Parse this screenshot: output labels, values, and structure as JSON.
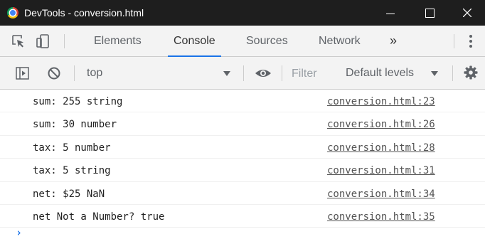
{
  "window": {
    "title": "DevTools - conversion.html"
  },
  "tabs": [
    {
      "label": "Elements",
      "active": false
    },
    {
      "label": "Console",
      "active": true
    },
    {
      "label": "Sources",
      "active": false
    },
    {
      "label": "Network",
      "active": false
    }
  ],
  "more_tabs_glyph": "»",
  "toolbar": {
    "context": "top",
    "filter_placeholder": "Filter",
    "levels_label": "Default levels"
  },
  "messages": [
    {
      "text": "sum: 255 string",
      "source": "conversion.html:23"
    },
    {
      "text": "sum: 30 number",
      "source": "conversion.html:26"
    },
    {
      "text": "tax: 5 number",
      "source": "conversion.html:28"
    },
    {
      "text": "tax: 5 string",
      "source": "conversion.html:31"
    },
    {
      "text": "net: $25 NaN",
      "source": "conversion.html:34"
    },
    {
      "text": "net Not a Number? true",
      "source": "conversion.html:35"
    }
  ],
  "prompt_glyph": "›",
  "icons": [
    "chrome-icon",
    "minimize-icon",
    "maximize-icon",
    "close-icon",
    "inspect-element-icon",
    "device-toolbar-icon",
    "more-tabs-icon",
    "kebab-menu-icon",
    "sidebar-toggle-icon",
    "clear-console-icon",
    "live-expression-eye-icon",
    "settings-gear-icon"
  ],
  "colors": {
    "titlebar": "#1e1e1e",
    "accent": "#1a73e8",
    "toolbar_bg": "#f3f3f3"
  }
}
